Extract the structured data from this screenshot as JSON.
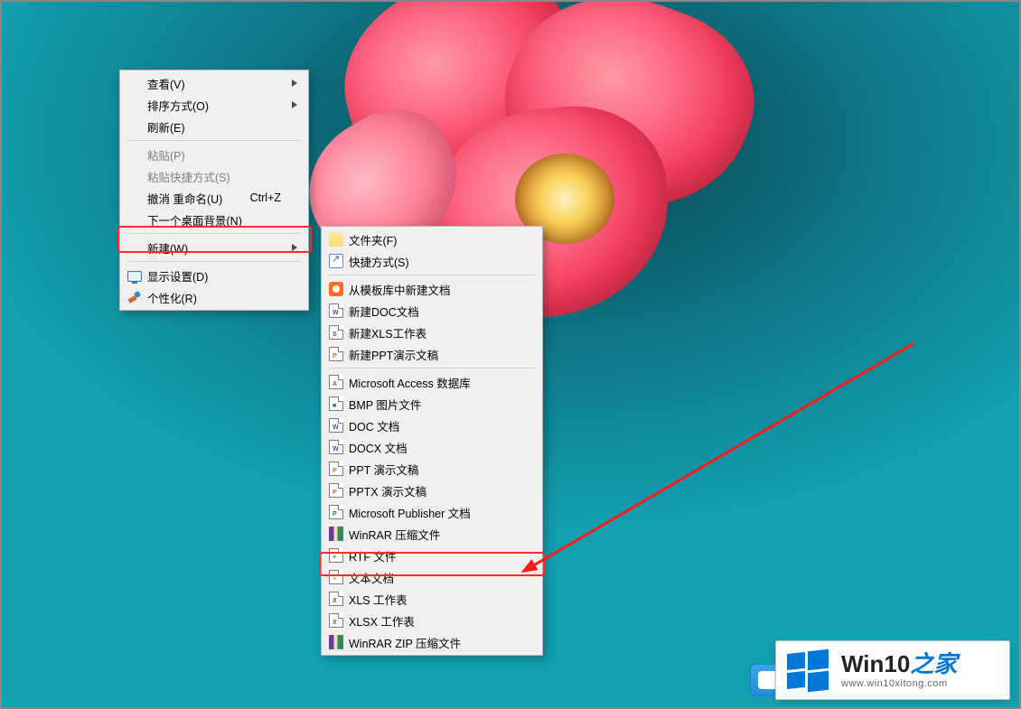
{
  "primary_menu": {
    "view": {
      "label": "查看(V)"
    },
    "sort": {
      "label": "排序方式(O)"
    },
    "refresh": {
      "label": "刷新(E)"
    },
    "paste": {
      "label": "粘贴(P)"
    },
    "paste_sc": {
      "label": "粘贴快捷方式(S)"
    },
    "undo": {
      "label": "撤消 重命名(U)",
      "shortcut": "Ctrl+Z"
    },
    "next_bg": {
      "label": "下一个桌面背景(N)"
    },
    "new": {
      "label": "新建(W)"
    },
    "display": {
      "label": "显示设置(D)"
    },
    "personalize": {
      "label": "个性化(R)"
    }
  },
  "sub_menu": {
    "folder": {
      "label": "文件夹(F)"
    },
    "shortcut": {
      "label": "快捷方式(S)"
    },
    "wps_tpl": {
      "label": "从模板库中新建文档"
    },
    "wps_doc": {
      "label": "新建DOC文档"
    },
    "wps_xls": {
      "label": "新建XLS工作表"
    },
    "wps_ppt": {
      "label": "新建PPT演示文稿"
    },
    "access": {
      "label": "Microsoft Access 数据库"
    },
    "bmp": {
      "label": "BMP 图片文件"
    },
    "doc": {
      "label": "DOC 文档"
    },
    "docx": {
      "label": "DOCX 文档"
    },
    "ppt": {
      "label": "PPT 演示文稿"
    },
    "pptx": {
      "label": "PPTX 演示文稿"
    },
    "publisher": {
      "label": "Microsoft Publisher 文档"
    },
    "winrar": {
      "label": "WinRAR 压缩文件"
    },
    "rtf": {
      "label": "RTF 文件"
    },
    "txt": {
      "label": "文本文档"
    },
    "xls": {
      "label": "XLS 工作表"
    },
    "xlsx": {
      "label": "XLSX 工作表"
    },
    "winrar_zip": {
      "label": "WinRAR ZIP 压缩文件"
    }
  },
  "watermark": {
    "title_a": "Win10",
    "title_b": "之家",
    "url": "www.win10xitong.com"
  }
}
